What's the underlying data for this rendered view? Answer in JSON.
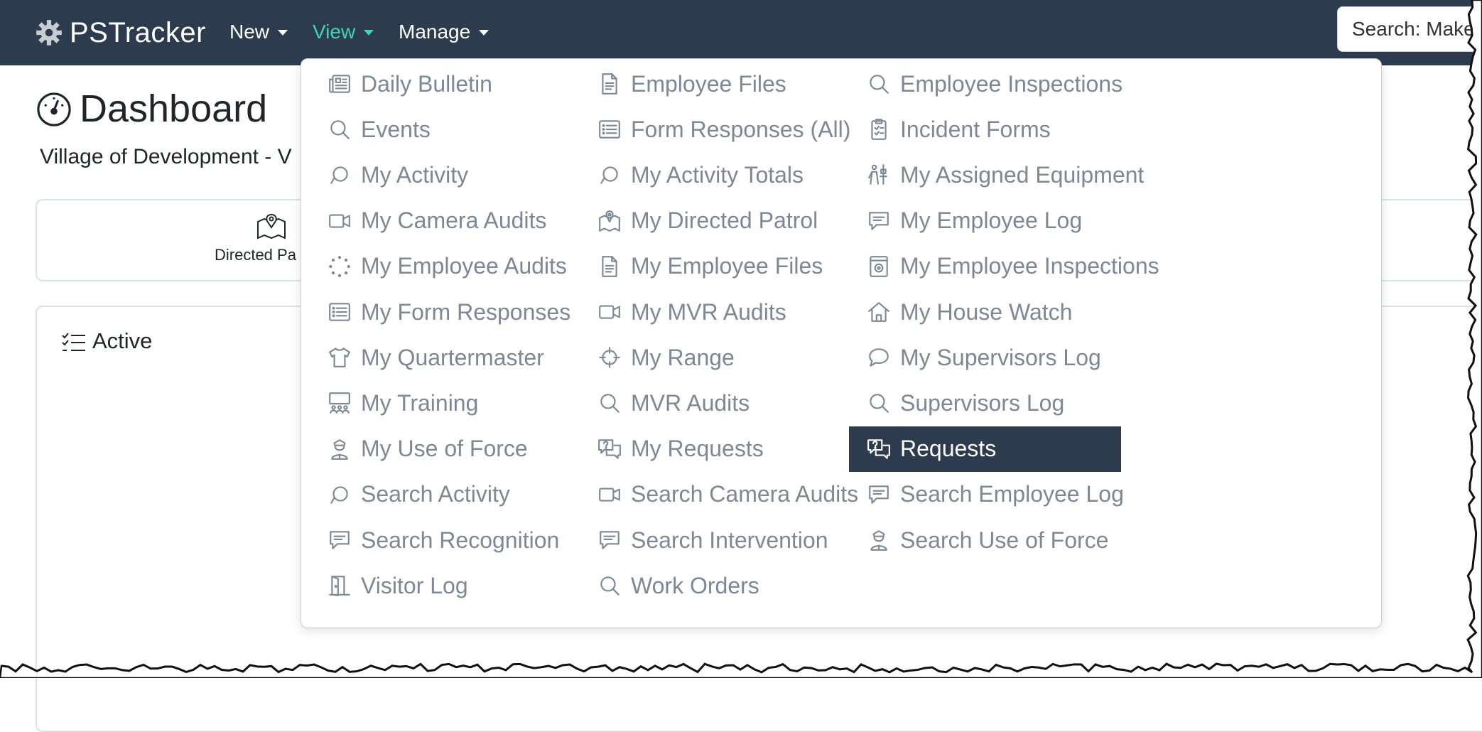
{
  "app": {
    "name": "PSTracker"
  },
  "nav": {
    "new_label": "New",
    "view_label": "View",
    "manage_label": "Manage",
    "active_color": "#3dd6b5",
    "navbar_color": "#2d3b4e"
  },
  "search": {
    "placeholder": "Search: Make,"
  },
  "page": {
    "title": "Dashboard",
    "subtitle": "Village of Development - V",
    "card1_label": "Directed Pa",
    "active_label": "Active"
  },
  "menu": {
    "highlight_color": "#2d3b4e",
    "columns": [
      [
        {
          "label": "Daily Bulletin",
          "icon": "newspaper-icon"
        },
        {
          "label": "Events",
          "icon": "search-icon"
        },
        {
          "label": "My Activity",
          "icon": "activity-icon"
        },
        {
          "label": "My Camera Audits",
          "icon": "camera-icon"
        },
        {
          "label": "My Employee Audits",
          "icon": "dotted-circle-icon"
        },
        {
          "label": "My Form Responses",
          "icon": "list-icon"
        },
        {
          "label": "My Quartermaster",
          "icon": "shirt-icon"
        },
        {
          "label": "My Training",
          "icon": "classroom-icon"
        },
        {
          "label": "My Use of Force",
          "icon": "officer-icon"
        },
        {
          "label": "Search Activity",
          "icon": "activity-icon"
        },
        {
          "label": "Search Recognition",
          "icon": "message-icon"
        },
        {
          "label": "Visitor Log",
          "icon": "door-icon"
        }
      ],
      [
        {
          "label": "Employee Files",
          "icon": "file-icon"
        },
        {
          "label": "Form Responses (All)",
          "icon": "list-icon"
        },
        {
          "label": "My Activity Totals",
          "icon": "activity-icon"
        },
        {
          "label": "My Directed Patrol",
          "icon": "map-pin-icon"
        },
        {
          "label": "My Employee Files",
          "icon": "file-icon"
        },
        {
          "label": "My MVR Audits",
          "icon": "camera-icon"
        },
        {
          "label": "My Range",
          "icon": "crosshair-icon"
        },
        {
          "label": "MVR Audits",
          "icon": "search-icon"
        },
        {
          "label": "My Requests",
          "icon": "question-chat-icon"
        },
        {
          "label": "Search Camera Audits",
          "icon": "camera-icon"
        },
        {
          "label": "Search Intervention",
          "icon": "message-icon"
        },
        {
          "label": "Work Orders",
          "icon": "search-icon"
        }
      ],
      [
        {
          "label": "Employee Inspections",
          "icon": "search-icon"
        },
        {
          "label": "Incident Forms",
          "icon": "clipboard-icon"
        },
        {
          "label": "My Assigned Equipment",
          "icon": "equipment-icon"
        },
        {
          "label": "My Employee Log",
          "icon": "message-icon"
        },
        {
          "label": "My Employee Inspections",
          "icon": "inspection-icon"
        },
        {
          "label": "My House Watch",
          "icon": "house-icon"
        },
        {
          "label": "My Supervisors Log",
          "icon": "chat-icon"
        },
        {
          "label": "Supervisors Log",
          "icon": "search-icon"
        },
        {
          "label": "Requests",
          "icon": "question-chat-icon",
          "highlighted": true
        },
        {
          "label": "Search Employee Log",
          "icon": "message-icon"
        },
        {
          "label": "Search Use of Force",
          "icon": "officer-icon"
        }
      ]
    ]
  }
}
